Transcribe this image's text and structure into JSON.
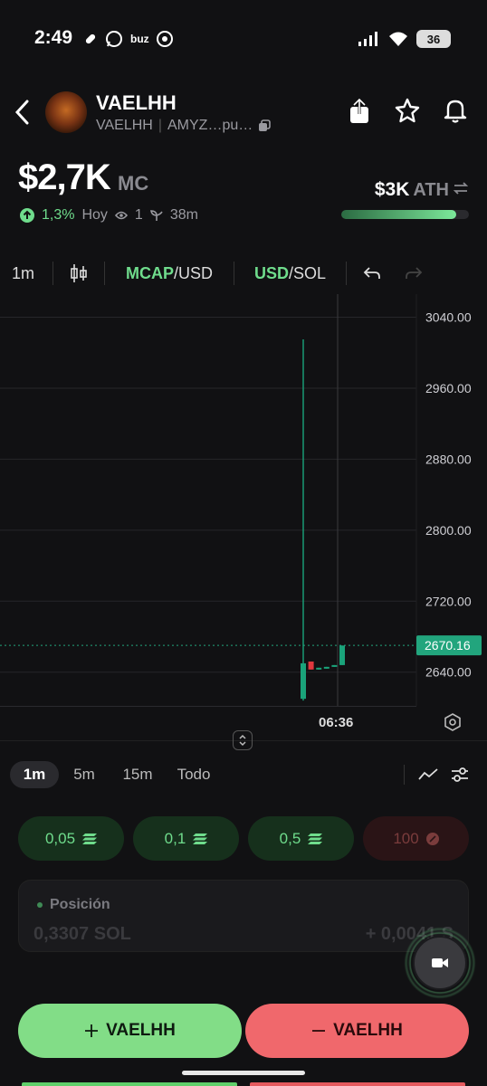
{
  "status_bar": {
    "time": "2:49",
    "app_badge": "buz",
    "battery": "36"
  },
  "header": {
    "token_name": "VAELHH",
    "symbol": "VAELHH",
    "address": "AMYZ…pu…"
  },
  "price": {
    "market_cap": "$2,7K",
    "mc_label": "MC",
    "change": "1,3%",
    "period": "Hoy",
    "views": "1",
    "age": "38m",
    "ath_value": "$3K",
    "ath_label": "ATH",
    "ath_progress": 0.9
  },
  "chart_toolbar": {
    "interval": "1m",
    "mcap_label": "MCAP",
    "mcap_quote": "/USD",
    "usd_label": "USD",
    "usd_quote": "/SOL"
  },
  "chart_data": {
    "type": "candlestick",
    "y_ticks": [
      "3040.00",
      "2960.00",
      "2880.00",
      "2800.00",
      "2720.00",
      "2640.00"
    ],
    "ylim": [
      2602,
      3066
    ],
    "current_price": "2670.16",
    "x_label": "06:36",
    "candles": [
      {
        "open": 2650,
        "close": 2610,
        "high": 3015,
        "low": 2608,
        "color": "green"
      },
      {
        "open": 2652,
        "close": 2643,
        "high": 2652,
        "low": 2643,
        "color": "red"
      },
      {
        "open": 2644,
        "close": 2645,
        "high": 2645,
        "low": 2643,
        "color": "green"
      },
      {
        "open": 2645,
        "close": 2646,
        "high": 2646,
        "low": 2644,
        "color": "green"
      },
      {
        "open": 2647,
        "close": 2648,
        "high": 2648,
        "low": 2646,
        "color": "green"
      },
      {
        "open": 2648,
        "close": 2670,
        "high": 2670,
        "low": 2648,
        "color": "green"
      }
    ]
  },
  "timeframes": [
    "1m",
    "5m",
    "15m",
    "Todo"
  ],
  "quick_buy": [
    {
      "label": "0,05",
      "enabled": true
    },
    {
      "label": "0,1",
      "enabled": true
    },
    {
      "label": "0,5",
      "enabled": true
    },
    {
      "label": "100",
      "enabled": false
    }
  ],
  "position": {
    "title": "Posición",
    "amount_left": "0,3307 SOL",
    "amount_right": "+ 0,0041 S"
  },
  "actions": {
    "buy_label": "VAELHH",
    "sell_label": "VAELHH"
  },
  "colors": {
    "accent_green": "#6fdc8c",
    "buy_button": "#82dd87",
    "sell_button": "#f0686c",
    "candle_up": "#1aa37a",
    "candle_down": "#e0383e",
    "price_tag": "#22a57d"
  }
}
